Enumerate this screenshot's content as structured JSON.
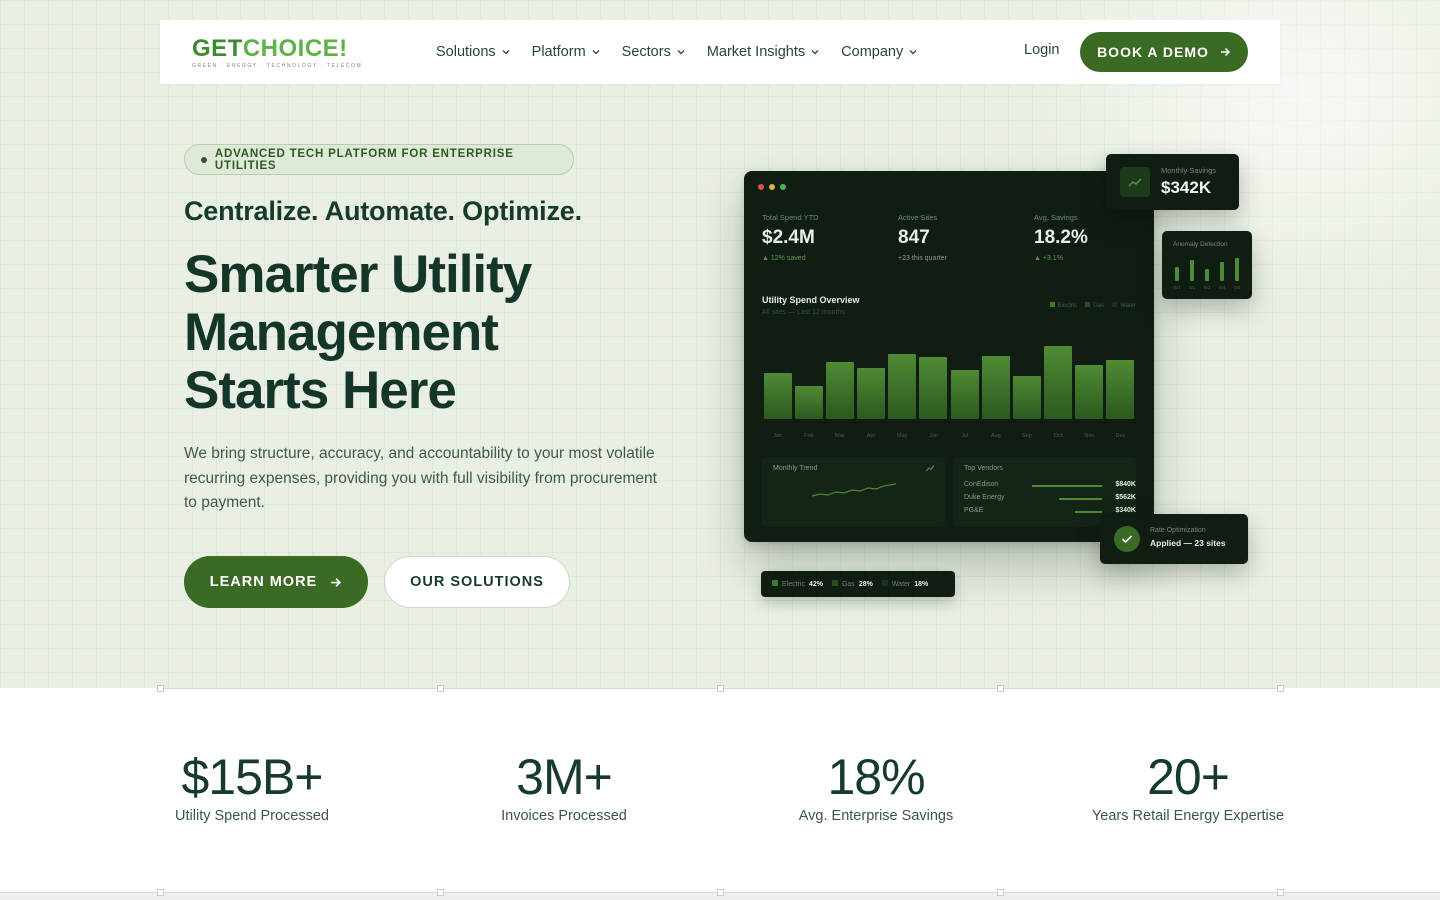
{
  "brand": {
    "logo_get": "GET",
    "logo_choice": "CHOICE!",
    "logo_tagline": "GREEN · ENERGY · TECHNOLOGY · TELECOM"
  },
  "nav": {
    "items": [
      {
        "label": "Solutions"
      },
      {
        "label": "Platform"
      },
      {
        "label": "Sectors"
      },
      {
        "label": "Market Insights"
      },
      {
        "label": "Company"
      }
    ],
    "login_label": "Login",
    "demo_label": "BOOK A DEMO"
  },
  "hero": {
    "badge": "ADVANCED TECH PLATFORM FOR ENTERPRISE UTILITIES",
    "tagline": "Centralize. Automate. Optimize.",
    "headline_1": "Smarter Utility",
    "headline_2": "Management",
    "headline_3": "Starts Here",
    "subtext": "We bring structure, accuracy, and accountability to your most volatile recurring expenses, providing you with full visibility from procurement to payment.",
    "learn_more_label": "LEARN MORE",
    "solutions_label": "OUR SOLUTIONS"
  },
  "dashboard": {
    "kpis": [
      {
        "label": "Total Spend YTD",
        "value": "$2.4M",
        "note": "12% saved"
      },
      {
        "label": "Active Sites",
        "value": "847",
        "note": "+23 this quarter"
      },
      {
        "label": "Avg. Savings",
        "value": "18.2%",
        "note": "+3.1%"
      }
    ],
    "chart_title": "Utility Spend Overview",
    "chart_subtitle": "All sites — Last 12 months",
    "chart_legend": [
      "Electric",
      "Gas",
      "Water"
    ],
    "months": [
      "Jan",
      "Feb",
      "Mar",
      "Apr",
      "May",
      "Jun",
      "Jul",
      "Aug",
      "Sep",
      "Oct",
      "Nov",
      "Dec"
    ],
    "bar_levels": [
      0.52,
      0.38,
      0.65,
      0.58,
      0.74,
      0.7,
      0.56,
      0.72,
      0.49,
      0.83,
      0.61,
      0.67
    ],
    "trend_title": "Monthly Trend",
    "vendors_title": "Top Vendors",
    "vendors": [
      {
        "name": "ConEdison",
        "amount": "$840K",
        "share": 1.0
      },
      {
        "name": "Duke Energy",
        "amount": "$562K",
        "share": 0.62
      },
      {
        "name": "PG&E",
        "amount": "$340K",
        "share": 0.38
      }
    ],
    "savings_card": {
      "label": "Monthly Savings",
      "value": "$342K"
    },
    "anomaly_card": {
      "title": "Anomaly Detection",
      "labels": [
        "W1",
        "W2",
        "W3",
        "W4",
        "W5"
      ],
      "levels": [
        0.55,
        0.8,
        0.45,
        0.75,
        0.9
      ]
    },
    "rate_card": {
      "label": "Rate Optimization",
      "value": "Applied — 23 sites"
    },
    "energy_mix": [
      {
        "name": "Electric",
        "pct": "42%",
        "color": "#3d7a2a"
      },
      {
        "name": "Gas",
        "pct": "28%",
        "color": "#2a4f20"
      },
      {
        "name": "Water",
        "pct": "18%",
        "color": "#1f2f20"
      }
    ]
  },
  "stats": [
    {
      "value": "$15B+",
      "label": "Utility Spend Processed"
    },
    {
      "value": "3M+",
      "label": "Invoices Processed"
    },
    {
      "value": "18%",
      "label": "Avg. Enterprise Savings"
    },
    {
      "value": "20+",
      "label": "Years Retail Energy Expertise"
    }
  ],
  "colors": {
    "brand_green": "#3b6a24",
    "hero_bg": "#e9f0e3",
    "text_dark": "#133629",
    "dash_bg": "#0f1d12"
  }
}
